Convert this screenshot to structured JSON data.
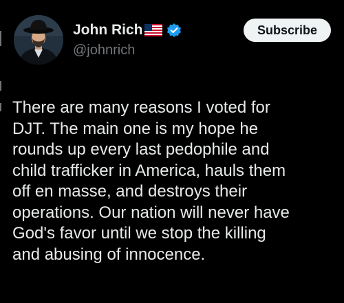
{
  "author": {
    "display_name": "John Rich",
    "handle": "@johnrich",
    "flag_icon": "us-flag-emoji",
    "verified_icon": "verified-badge-icon"
  },
  "actions": {
    "subscribe_label": "Subscribe"
  },
  "tweet": {
    "text": "There are many reasons I voted for\nDJT. The main one is my hope he\nrounds up every last pedophile and\nchild trafficker in America, hauls them\noff en masse, and destroys their\noperations. Our nation will never have\nGod's favor until we stop the killing\nand abusing of innocence."
  },
  "colors": {
    "background": "#000000",
    "text_primary": "#e7e9ea",
    "text_secondary": "#71767b",
    "verified_blue": "#1d9bf0",
    "button_bg": "#eff3f4",
    "button_text": "#0f1419"
  }
}
